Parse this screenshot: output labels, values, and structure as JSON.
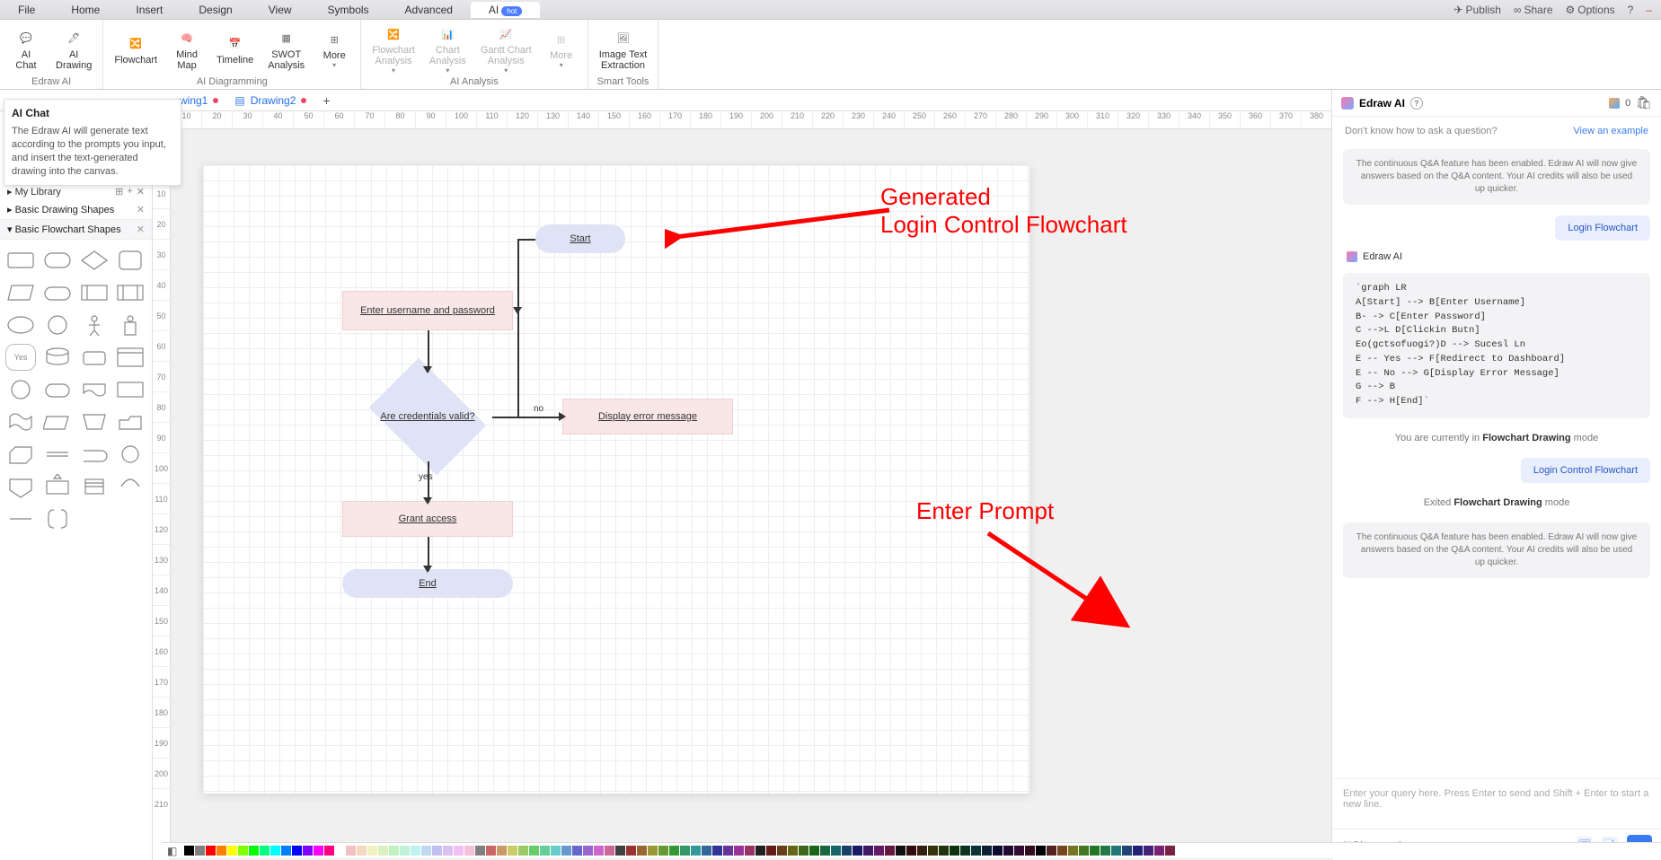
{
  "menu": [
    "File",
    "Home",
    "Insert",
    "Design",
    "View",
    "Symbols",
    "Advanced",
    "AI"
  ],
  "menu_active": 7,
  "hot_badge": "hot",
  "top_right": {
    "publish": "Publish",
    "share": "Share",
    "options": "Options"
  },
  "ribbon": {
    "groups": [
      {
        "label": "Edraw AI",
        "buttons": [
          {
            "icon": "💬",
            "name": "ai-chat",
            "label": "AI\nChat"
          },
          {
            "icon": "🖊",
            "name": "ai-drawing",
            "label": "AI\nDrawing"
          }
        ]
      },
      {
        "label": "AI Diagramming",
        "buttons": [
          {
            "icon": "🔀",
            "name": "flowchart",
            "label": "Flowchart"
          },
          {
            "icon": "🧠",
            "name": "mind-map",
            "label": "Mind\nMap"
          },
          {
            "icon": "📅",
            "name": "timeline",
            "label": "Timeline"
          },
          {
            "icon": "▦",
            "name": "swot",
            "label": "SWOT\nAnalysis"
          },
          {
            "icon": "⊞",
            "name": "more-diagram",
            "label": "More",
            "caret": true
          }
        ]
      },
      {
        "label": "AI Analysis",
        "dim": true,
        "buttons": [
          {
            "icon": "🔀",
            "name": "flowchart-analysis",
            "label": "Flowchart\nAnalysis",
            "caret": true
          },
          {
            "icon": "📊",
            "name": "chart-analysis",
            "label": "Chart\nAnalysis",
            "caret": true
          },
          {
            "icon": "📈",
            "name": "gantt-analysis",
            "label": "Gantt Chart\nAnalysis",
            "caret": true
          },
          {
            "icon": "⊞",
            "name": "more-analysis",
            "label": "More",
            "caret": true
          }
        ]
      },
      {
        "label": "Smart Tools",
        "buttons": [
          {
            "icon": "🖼",
            "name": "image-text-extraction",
            "label": "Image Text\nExtraction"
          }
        ]
      }
    ]
  },
  "tooltip": {
    "title": "AI Chat",
    "body": "The Edraw AI will generate text according to the prompts you input, and insert the text-generated drawing into the canvas."
  },
  "tabs": [
    {
      "name": "wing1",
      "dirty": true
    },
    {
      "name": "Drawing2",
      "dirty": true
    }
  ],
  "ruler_start": 10,
  "ruler_step": 10,
  "ruler_count": 38,
  "ruler_v_start": 0,
  "ruler_v_step": 10,
  "ruler_v_count": 22,
  "left_panel": {
    "lib": "My Library",
    "section1": "Basic Drawing Shapes",
    "section2": "Basic Flowchart Shapes"
  },
  "flowchart": {
    "start": "Start",
    "input": "Enter username and password",
    "decision": "Are credentials valid?",
    "no": "no",
    "yes": "yes",
    "error": "Display error message",
    "grant": "Grant access",
    "end": "End"
  },
  "annotations": {
    "generated": "Generated\nLogin Control Flowchart",
    "enter_prompt": "Enter Prompt"
  },
  "right_panel": {
    "title": "Edraw AI",
    "credits": "0",
    "hint": "Don't know how to ask a question?",
    "link": "View an example",
    "sys_msg": "The continuous Q&A feature has been enabled. Edraw AI will now give answers based on the Q&A content. Your AI credits will also be used up quicker.",
    "user1": "Login Flowchart",
    "ai_name": "Edraw AI",
    "ai_code": "`graph LR\nA[Start] --> B[Enter Username]\nB- -> C[Enter Password]\nC -->L D[Clickin Butn]\nEo(gctsofuogi?)D --> Sucesl Ln\nE -- Yes --> F[Redirect to Dashboard]\nE -- No --> G[Display Error Message]\nG --> B\nF --> H[End]`",
    "mode_pre1": "You are currently in ",
    "mode_bold1": "Flowchart Drawing",
    "mode_post1": " mode",
    "user2": "Login Control Flowchart",
    "mode_pre2": "Exited ",
    "mode_bold2": "Flowchart Drawing",
    "mode_post2": " mode",
    "input_placeholder": "Enter your query here. Press Enter to send and Shift + Enter to start a new line.",
    "mode_selector": "AI Diagramming"
  },
  "colors": [
    "#000000",
    "#7f7f7f",
    "#ff0000",
    "#ff8000",
    "#ffff00",
    "#80ff00",
    "#00ff00",
    "#00ff80",
    "#00ffff",
    "#0080ff",
    "#0000ff",
    "#8000ff",
    "#ff00ff",
    "#ff0080",
    "#ffffff",
    "#f2c0c0",
    "#f2d9c0",
    "#f2f2c0",
    "#d9f2c0",
    "#c0f2c0",
    "#c0f2d9",
    "#c0f2f2",
    "#c0d9f2",
    "#c0c0f2",
    "#d9c0f2",
    "#f2c0f2",
    "#f2c0d9",
    "#808080",
    "#cc6666",
    "#cc9966",
    "#cccc66",
    "#99cc66",
    "#66cc66",
    "#66cc99",
    "#66cccc",
    "#6699cc",
    "#6666cc",
    "#9966cc",
    "#cc66cc",
    "#cc6699",
    "#404040",
    "#993333",
    "#996633",
    "#999933",
    "#669933",
    "#339933",
    "#339966",
    "#339999",
    "#336699",
    "#333399",
    "#663399",
    "#993399",
    "#993366",
    "#202020",
    "#661919",
    "#664019",
    "#666619",
    "#406619",
    "#196619",
    "#196640",
    "#196666",
    "#194066",
    "#191966",
    "#401966",
    "#661966",
    "#661940",
    "#101010",
    "#330c0c",
    "#33200c",
    "#33330c",
    "#20330c",
    "#0c330c",
    "#0c3320",
    "#0c3333",
    "#0c2033",
    "#0c0c33",
    "#200c33",
    "#330c33",
    "#330c20",
    "#000000",
    "#552222",
    "#774422",
    "#777722",
    "#447722",
    "#227722",
    "#227744",
    "#227777",
    "#224477",
    "#222277",
    "#442277",
    "#772277",
    "#772244"
  ]
}
